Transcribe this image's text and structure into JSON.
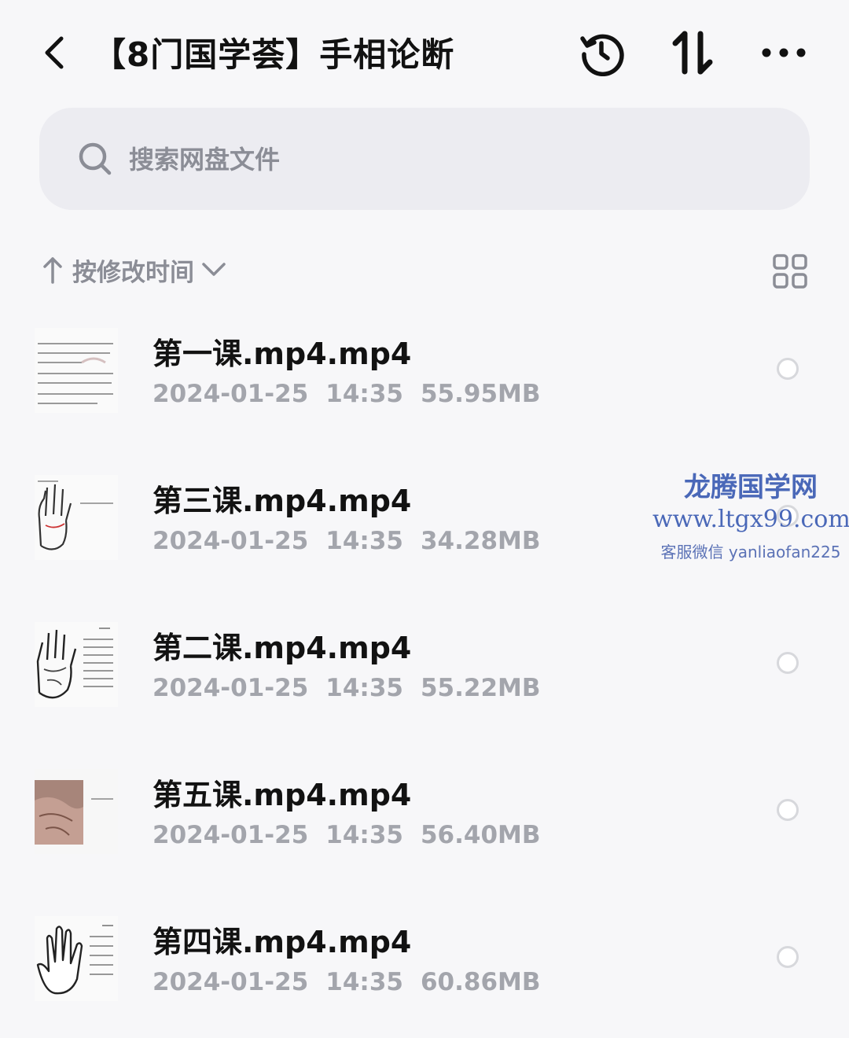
{
  "header": {
    "back_icon": "chevron-left-icon",
    "title": "【8门国学荟】手相论断",
    "actions": [
      {
        "name": "history",
        "icon": "history-clock-icon"
      },
      {
        "name": "sort-toggle",
        "icon": "up-down-arrows-icon"
      },
      {
        "name": "more",
        "icon": "more-dots-icon"
      }
    ]
  },
  "search": {
    "icon": "search-icon",
    "placeholder": "搜索网盘文件"
  },
  "sortbar": {
    "direction_icon": "arrow-up-icon",
    "label": "按修改时间",
    "dropdown_icon": "chevron-down-icon",
    "view_icon": "grid-view-icon"
  },
  "files": [
    {
      "name": "第一课.mp4.mp4",
      "date": "2024-01-25",
      "time": "14:35",
      "size": "55.95MB",
      "thumb": "text-slide"
    },
    {
      "name": "第三课.mp4.mp4",
      "date": "2024-01-25",
      "time": "14:35",
      "size": "34.28MB",
      "thumb": "palm-drawing-slide"
    },
    {
      "name": "第二课.mp4.mp4",
      "date": "2024-01-25",
      "time": "14:35",
      "size": "55.22MB",
      "thumb": "palm-lines-slide"
    },
    {
      "name": "第五课.mp4.mp4",
      "date": "2024-01-25",
      "time": "14:35",
      "size": "56.40MB",
      "thumb": "palm-photo-slide"
    },
    {
      "name": "第四课.mp4.mp4",
      "date": "2024-01-25",
      "time": "14:35",
      "size": "60.86MB",
      "thumb": "hand-outline-slide"
    }
  ],
  "watermark": {
    "title": "龙腾国学网",
    "url": "www.ltgx99.com",
    "contact": "客服微信 yanliaofan225"
  },
  "colors": {
    "background": "#f7f7f9",
    "search_bg": "#ececf1",
    "meta_text": "#a3a5ac",
    "watermark": "#4a68b8"
  }
}
